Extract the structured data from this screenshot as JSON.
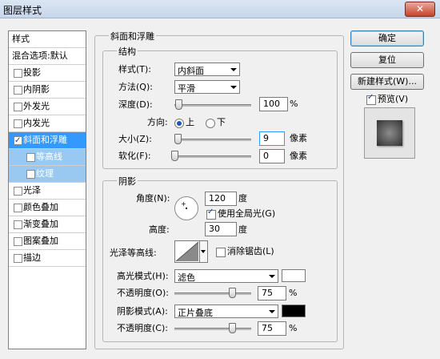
{
  "window": {
    "title": "图层样式",
    "close": "✕"
  },
  "styles_panel": {
    "header": "样式",
    "blend_options": "混合选项:默认",
    "items": [
      {
        "label": "投影",
        "checked": false
      },
      {
        "label": "内阴影",
        "checked": false
      },
      {
        "label": "外发光",
        "checked": false
      },
      {
        "label": "内发光",
        "checked": false
      },
      {
        "label": "斜面和浮雕",
        "checked": true
      },
      {
        "label": "等高线",
        "checked": false
      },
      {
        "label": "纹理",
        "checked": false
      },
      {
        "label": "光泽",
        "checked": false
      },
      {
        "label": "颜色叠加",
        "checked": false
      },
      {
        "label": "渐变叠加",
        "checked": false
      },
      {
        "label": "图案叠加",
        "checked": false
      },
      {
        "label": "描边",
        "checked": false
      }
    ]
  },
  "bevel": {
    "group_title": "斜面和浮雕",
    "structure": {
      "title": "结构",
      "style_label": "样式(T):",
      "style_value": "内斜面",
      "technique_label": "方法(Q):",
      "technique_value": "平滑",
      "depth_label": "深度(D):",
      "depth_value": "100",
      "depth_unit": "%",
      "depth_level": 0.05,
      "direction_label": "方向:",
      "direction_up": "上",
      "direction_down": "下",
      "direction_selected": "up",
      "size_label": "大小(Z):",
      "size_value": "9",
      "size_unit": "像素",
      "size_level": 0.04,
      "soften_label": "软化(F):",
      "soften_value": "0",
      "soften_unit": "像素",
      "soften_level": 0.0
    },
    "shading": {
      "title": "阴影",
      "angle_label": "角度(N):",
      "angle_value": "120",
      "angle_unit": "度",
      "global_light_label": "使用全局光(G)",
      "global_light_checked": true,
      "altitude_label": "高度:",
      "altitude_value": "30",
      "altitude_unit": "度",
      "gloss_contour_label": "光泽等高线:",
      "antialias_label": "消除锯齿(L)",
      "antialias_checked": false,
      "highlight_mode_label": "高光模式(H):",
      "highlight_mode_value": "滤色",
      "highlight_color": "#ffffff",
      "highlight_opacity_label": "不透明度(O):",
      "highlight_opacity_value": "75",
      "highlight_opacity_level": 0.75,
      "shadow_mode_label": "阴影模式(A):",
      "shadow_mode_value": "正片叠底",
      "shadow_color": "#000000",
      "shadow_opacity_label": "不透明度(C):",
      "shadow_opacity_value": "75",
      "shadow_opacity_level": 0.75,
      "percent": "%"
    }
  },
  "buttons": {
    "ok": "确定",
    "reset": "复位",
    "new_style": "新建样式(W)...",
    "preview_label": "预览(V)",
    "preview_checked": true
  }
}
